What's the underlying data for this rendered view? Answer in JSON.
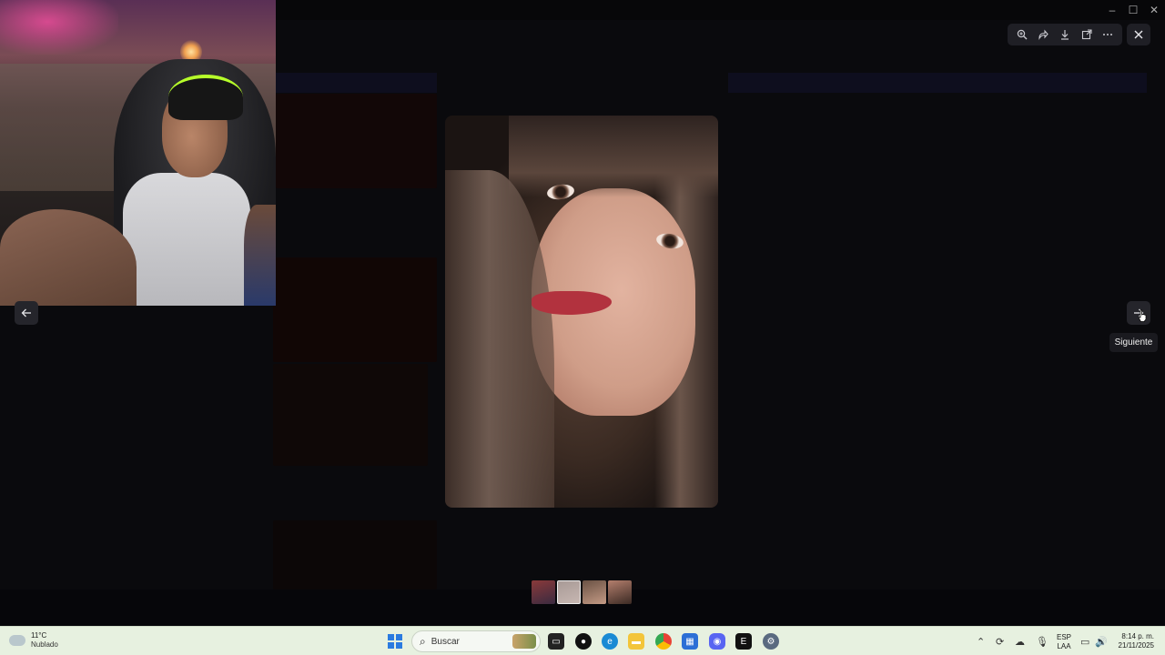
{
  "viewer": {
    "toolbar": {
      "zoom_icon": "zoom-in-icon",
      "forward_icon": "share-forward-icon",
      "download_icon": "download-icon",
      "open_icon": "open-external-icon",
      "more_icon": "more-options-icon"
    },
    "close_icon": "close-icon",
    "prev_icon": "arrow-left-icon",
    "next_icon": "arrow-right-icon",
    "next_tooltip": "Siguiente",
    "thumbnail_count": 4
  },
  "taskbar": {
    "weather": {
      "temp": "11°C",
      "condition": "Nublado"
    },
    "search_label": "Buscar",
    "language": {
      "line1": "ESP",
      "line2": "LAA"
    },
    "clock": {
      "time": "8:14 p. m.",
      "date": "21/11/2025"
    }
  },
  "colors": {
    "accent": "#2a7be0",
    "taskbar_bg": "#e7f1e0",
    "viewer_button_bg": "#1f1f25"
  }
}
